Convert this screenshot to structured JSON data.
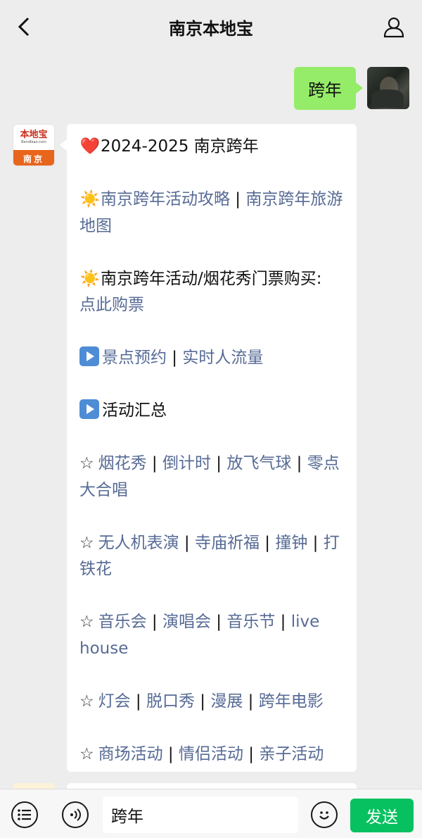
{
  "header": {
    "title": "南京本地宝"
  },
  "outgoing": {
    "text": "跨年"
  },
  "bot_avatar": {
    "logo_text": "本地宝",
    "logo_url": "Bendibao.com",
    "city": "南京"
  },
  "message": {
    "title_emoji": "❤️",
    "title": "2024-2025 南京跨年",
    "sun_emoji": "☀️",
    "line1_a": "南京跨年活动攻略",
    "line1_sep": " | ",
    "line1_b": "南京跨年旅游地图",
    "line2_text": "南京跨年活动/烟花秀门票购买:",
    "line2_link": "点此购票",
    "line3_a": "景点预约",
    "line3_sep": " | ",
    "line3_b": "实时人流量",
    "line4_text": "活动汇总",
    "star": "☆",
    "group1": [
      "烟花秀",
      "倒计时",
      "放飞气球",
      "零点大合唱"
    ],
    "group2": [
      "无人机表演",
      "寺庙祈福",
      "撞钟",
      "打铁花"
    ],
    "group3": [
      "音乐会",
      "演唱会",
      "音乐节",
      "live house"
    ],
    "group4": [
      "灯会",
      "脱口秀",
      "漫展",
      "跨年电影"
    ],
    "group5": [
      "商场活动",
      "情侣活动",
      "亲子活动"
    ],
    "pipe": " | "
  },
  "input_bar": {
    "value": "跨年",
    "send_label": "发送"
  }
}
